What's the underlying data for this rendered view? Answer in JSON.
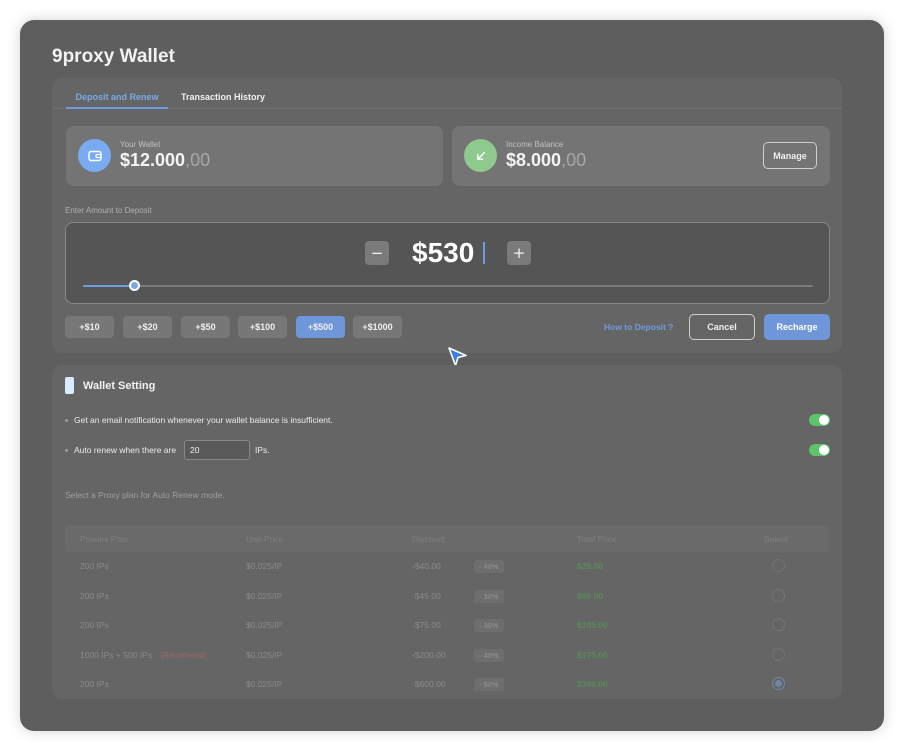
{
  "app": {
    "title": "9proxy Wallet"
  },
  "tabs": [
    {
      "label": "Deposit and Renew",
      "active": true
    },
    {
      "label": "Transaction History",
      "active": false
    }
  ],
  "wallet_card": {
    "label": "Your Wallet",
    "amount_main": "$12.000",
    "amount_cents": ",00",
    "icon": "wallet-icon"
  },
  "income_card": {
    "label": "Income Balance",
    "amount_main": "$8.000",
    "amount_cents": ",00",
    "icon": "arrow-down-left-icon",
    "manage_label": "Manage"
  },
  "deposit": {
    "label": "Enter Amount to Deposit",
    "amount": "$530",
    "minus": "−",
    "plus": "+",
    "slider_fraction": 0.07
  },
  "quick_amounts": [
    "+$10",
    "+$20",
    "+$50",
    "+$100",
    "+$500",
    "+$1000"
  ],
  "quick_selected": 4,
  "actions": {
    "how_to": "How to Deposit ?",
    "cancel": "Cancel",
    "recharge": "Recharge"
  },
  "wallet_setting": {
    "title": "Wallet Setting",
    "email_notice": "Get an email notification whenever your wallet balance is insufficient.",
    "email_enabled": true,
    "auto_renew_prefix": "Auto renew when there are",
    "auto_renew_value": "20",
    "auto_renew_suffix": "IPs.",
    "auto_renew_enabled": true,
    "select_hint": "Select a Proxy plan for Auto Renew mode."
  },
  "plans": {
    "headers": [
      "Proxies Plan",
      "Unit-Price",
      "Discount",
      "Total Price",
      "Select"
    ],
    "rows": [
      {
        "plan": "200 IPs",
        "tag": "",
        "unit": "$0.025/IP",
        "discount": "-$40.00",
        "badge": "- 40%",
        "total": "$20.00",
        "selected": false
      },
      {
        "plan": "200 IPs",
        "tag": "",
        "unit": "$0.025/IP",
        "discount": "-$45.00",
        "badge": "- 30%",
        "total": "$60.00",
        "selected": false
      },
      {
        "plan": "200 IPs",
        "tag": "",
        "unit": "$0.025/IP",
        "discount": "-$75.00",
        "badge": "- 30%",
        "total": "$105.00",
        "selected": false
      },
      {
        "plan": "1000 IPs + 500 IPs",
        "tag": "(Recomend)",
        "unit": "$0.025/IP",
        "discount": "-$200.00",
        "badge": "- 40%",
        "total": "$175.00",
        "selected": false
      },
      {
        "plan": "200 IPs",
        "tag": "",
        "unit": "$0.025/IP",
        "discount": "-$600.00",
        "badge": "- 50%",
        "total": "$300.00",
        "selected": true
      }
    ]
  },
  "colors": {
    "accent": "#6f9be0",
    "toggle_on": "#5cc56a",
    "income_icon": "#8ec98e",
    "wallet_icon": "#7aaaf0"
  }
}
